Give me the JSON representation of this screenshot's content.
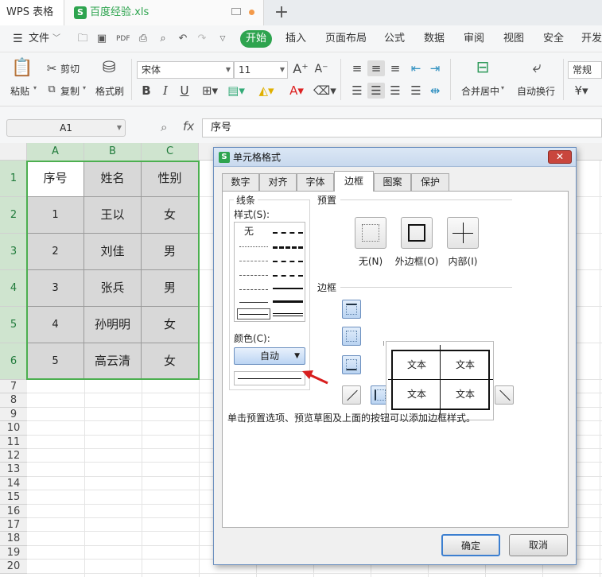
{
  "titlebar": {
    "app": "WPS 表格",
    "file": "百度经验.xls"
  },
  "menu": {
    "file": "文件",
    "items": [
      "开始",
      "插入",
      "页面布局",
      "公式",
      "数据",
      "审阅",
      "视图",
      "安全",
      "开发"
    ]
  },
  "ribbon": {
    "paste": "粘贴",
    "cut": "剪切",
    "copy": "复制",
    "format_painter": "格式刷",
    "font_name": "宋体",
    "font_size": "11",
    "merge": "合并居中",
    "wrap": "自动换行",
    "number_format": "常规"
  },
  "formula": {
    "name_box": "A1",
    "fx": "fx",
    "content": "序号"
  },
  "columns": [
    "A",
    "B",
    "C"
  ],
  "rows": [
    "1",
    "2",
    "3",
    "4",
    "5",
    "6",
    "7",
    "8",
    "9",
    "10",
    "11",
    "12",
    "13",
    "14",
    "15",
    "16",
    "17",
    "18",
    "19",
    "20"
  ],
  "table": [
    [
      "序号",
      "姓名",
      "性别"
    ],
    [
      "1",
      "王以",
      "女"
    ],
    [
      "2",
      "刘佳",
      "男"
    ],
    [
      "3",
      "张兵",
      "男"
    ],
    [
      "4",
      "孙明明",
      "女"
    ],
    [
      "5",
      "高云清",
      "女"
    ]
  ],
  "dialog": {
    "title": "单元格格式",
    "tabs": [
      "数字",
      "对齐",
      "字体",
      "边框",
      "图案",
      "保护"
    ],
    "active_tab": "边框",
    "line_group": "线条",
    "style_label": "样式(S):",
    "none_style": "无",
    "color_label": "颜色(C):",
    "color_value": "自动",
    "preset_group": "预置",
    "presets": [
      "无(N)",
      "外边框(O)",
      "内部(I)"
    ],
    "border_group": "边框",
    "preview_text": [
      "文本",
      "文本",
      "文本",
      "文本"
    ],
    "hint": "单击预置选项、预览草图及上面的按钮可以添加边框样式。",
    "ok": "确定",
    "cancel": "取消"
  },
  "colors": {
    "accent": "#2ea44f",
    "selection": "#4caf50",
    "arrow": "#d81e1e"
  }
}
